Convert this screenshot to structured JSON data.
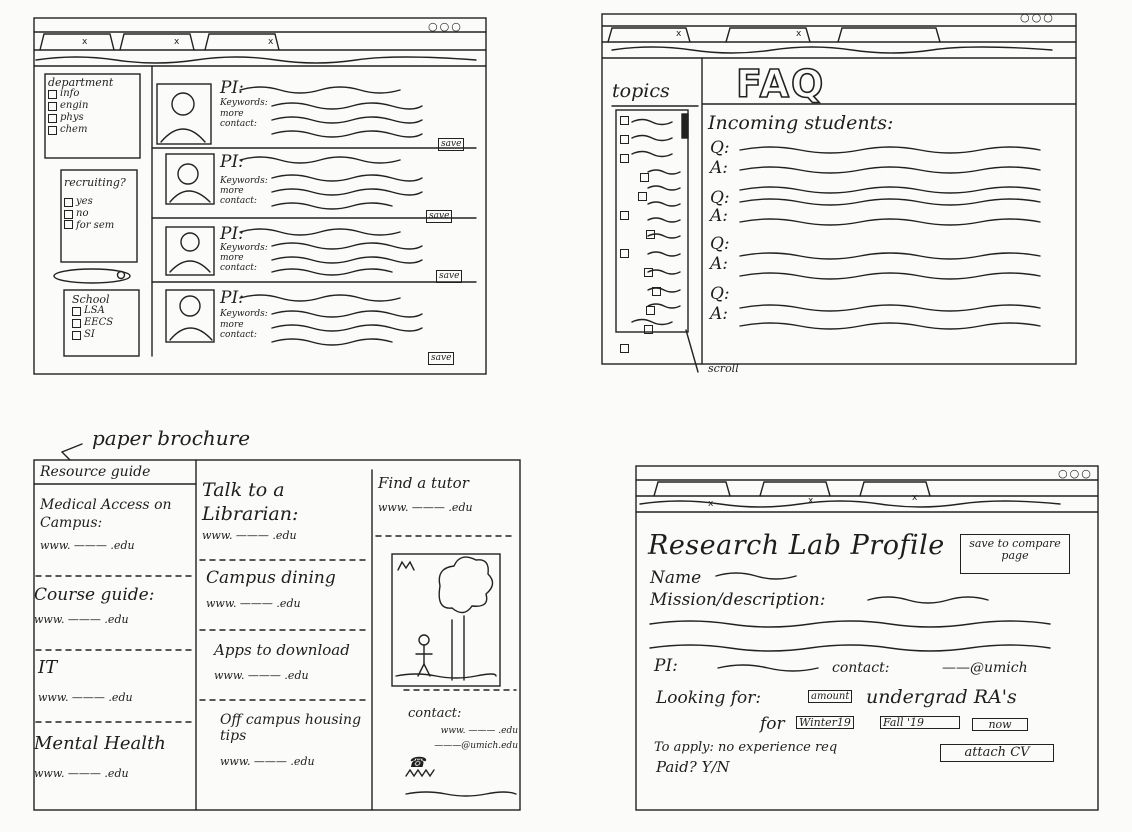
{
  "tabs_close_glyph": "x",
  "window_controls": [
    "○",
    "○",
    "○"
  ],
  "top_left": {
    "filters": {
      "department": {
        "title": "department",
        "options": [
          "info",
          "engin",
          "phys",
          "chem"
        ]
      },
      "recruiting": {
        "title": "recruiting?",
        "options": [
          "yes",
          "no",
          "for sem"
        ]
      },
      "school": {
        "title": "School",
        "options": [
          "LSA",
          "EECS",
          "SI"
        ]
      }
    },
    "cards": [
      {
        "pi": "PI:",
        "keywords": "Keywords:",
        "more": "more",
        "contact": "contact:",
        "save": "save"
      },
      {
        "pi": "PI:",
        "keywords": "Keywords:",
        "more": "more",
        "contact": "contact:",
        "save": "save"
      },
      {
        "pi": "PI:",
        "keywords": "Keywords:",
        "more": "more",
        "contact": "contact:",
        "save": "save"
      },
      {
        "pi": "PI:",
        "keywords": "Keywords:",
        "more": "more",
        "contact": "contact:",
        "save": "save"
      }
    ]
  },
  "top_right": {
    "topics": "topics",
    "faq": "FAQ",
    "section": "Incoming students:",
    "qa": [
      "Q:",
      "A:",
      "Q:",
      "A:",
      "Q:",
      "A:",
      "Q:",
      "A:"
    ],
    "scroll_note": "scroll"
  },
  "bottom_left": {
    "annotation": "paper brochure",
    "title": "Resource guide",
    "col1": [
      {
        "label": "Medical Access on Campus:",
        "url": "www. ——— .edu"
      },
      {
        "label": "Course guide:",
        "url": "www. ——— .edu"
      },
      {
        "label": "IT",
        "url": "www. ——— .edu"
      },
      {
        "label": "Mental Health",
        "url": "www. ——— .edu"
      }
    ],
    "col2": [
      {
        "label": "Talk to a Librarian:",
        "url": "www. ——— .edu"
      },
      {
        "label": "Campus dining",
        "url": "www. ——— .edu"
      },
      {
        "label": "Apps to download",
        "url": "www. ——— .edu"
      },
      {
        "label": "Off campus housing tips",
        "url": "www. ——— .edu"
      }
    ],
    "col3": {
      "label": "Find a tutor",
      "url": "www. ——— .edu",
      "contact": "contact:",
      "contact_url": "www. ——— .edu",
      "contact_email": "———@umich.edu"
    }
  },
  "bottom_right": {
    "title": "Research Lab Profile",
    "save_button": "save to compare page",
    "name": "Name",
    "mission": "Mission/description:",
    "pi": "PI:",
    "contact": "contact:",
    "contact_email": "——@umich",
    "looking_for": "Looking for:",
    "amount": "amount",
    "undergrad": "undergrad RA's",
    "for": "for",
    "terms": [
      "Winter19",
      "Fall '19",
      "now"
    ],
    "to_apply": "To apply: no experience req",
    "attach": "attach CV",
    "paid": "Paid? Y/N"
  }
}
